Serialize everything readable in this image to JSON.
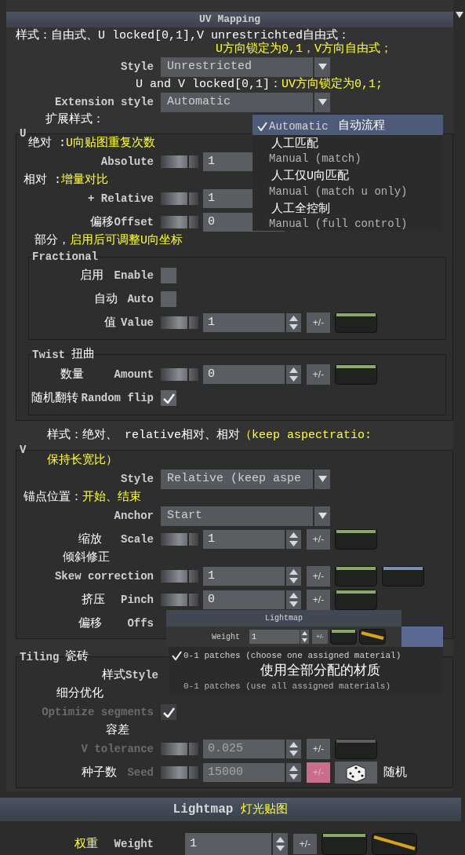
{
  "panel": {
    "title": "UV Mapping"
  },
  "style": {
    "label": "Style",
    "value": "Unrestricted"
  },
  "extension_style": {
    "label": "Extension style",
    "value": "Automatic"
  },
  "extension_menu": [
    {
      "label": "Automatic",
      "selected": true
    },
    {
      "label": "Manual (match)",
      "selected": false
    },
    {
      "label": "Manual (match u only)",
      "selected": false
    },
    {
      "label": "Manual (full control)",
      "selected": false
    }
  ],
  "u": {
    "title": "U",
    "rows": [
      {
        "label": "Absolute",
        "value": "1"
      },
      {
        "label": "+ Relative",
        "value": "1"
      },
      {
        "label": "Offset",
        "value": "0"
      }
    ]
  },
  "fractional": {
    "title": "Fractional",
    "checks": [
      {
        "label": "Enable",
        "checked": false
      },
      {
        "label": "Auto",
        "checked": false
      }
    ],
    "value": {
      "label": "Value",
      "value": "1",
      "button": "+/-",
      "curves": [
        {
          "kind": "flat",
          "color": "#8aa868"
        }
      ]
    }
  },
  "twist": {
    "title": "Twist",
    "amount": {
      "label": "Amount",
      "value": "0",
      "button": "+/-",
      "curves": [
        {
          "kind": "flat",
          "color": "#8aa868"
        }
      ]
    },
    "random_flip": {
      "label": "Random flip",
      "checked": true
    }
  },
  "v": {
    "title": "V",
    "style": {
      "label": "Style",
      "value": "Relative (keep aspe"
    },
    "anchor": {
      "label": "Anchor",
      "value": "Start"
    },
    "rows": [
      {
        "label": "Scale",
        "value": "1",
        "button": "+/-",
        "curves": [
          {
            "kind": "flat",
            "color": "#8aa868"
          }
        ]
      },
      {
        "label": "Skew correction",
        "value": "1",
        "button": "+/-",
        "curves": [
          {
            "kind": "flat",
            "color": "#8aa868"
          },
          {
            "kind": "flat",
            "color": "#7b8fae"
          }
        ]
      },
      {
        "label": "Pinch",
        "value": "0",
        "button": "+/-",
        "curves": [
          {
            "kind": "flat",
            "color": "#8aa868"
          }
        ]
      }
    ],
    "offset_label": "Offs"
  },
  "tiling": {
    "title": "Tiling",
    "style_label": "Style",
    "optimize": {
      "label": "Optimize segments",
      "checked": true,
      "disabled": true
    },
    "rows": [
      {
        "kind": "curve",
        "label": "V tolerance",
        "value": "0.025",
        "button": "+/-",
        "disabled": true,
        "keyed": false,
        "curves": [
          {
            "kind": "flat",
            "color": "#5e5e5e"
          }
        ]
      },
      {
        "kind": "dice",
        "label": "Seed",
        "value": "15000",
        "button": "+/-",
        "disabled": true,
        "keyed": true
      }
    ]
  },
  "popup": {
    "title": "Lightmap",
    "weight": {
      "label": "Weight",
      "value": "1",
      "button": "+/-",
      "curves": [
        {
          "kind": "flat",
          "color": "#8aa868"
        },
        {
          "kind": "ramp",
          "color": "#d8a31c"
        }
      ]
    },
    "menu": [
      {
        "label": "0-1 patches (choose one assigned material)",
        "selected": true
      },
      {
        "label": "0-1 patches (use all assigned materials)",
        "selected": false
      }
    ]
  },
  "lightmap": {
    "title": "Lightmap",
    "weight": {
      "label": "Weight",
      "value": "1",
      "button": "+/-",
      "curves": [
        {
          "kind": "flat",
          "color": "#8aa868"
        },
        {
          "kind": "ramp",
          "color": "#d8a31c"
        }
      ]
    }
  },
  "annotations": [
    {
      "segments": [
        {
          "text": "样式：自由式、U locked[0,1],V unrestrichted自由式：",
          "color": "#ffffff"
        }
      ]
    },
    {
      "segments": [
        {
          "text": "U方向锁定为0,1，V方向自由式；",
          "color": "#ffff33"
        }
      ]
    },
    {
      "segments": [
        {
          "text": "U and V locked[0,1]：",
          "color": "#ffffff"
        },
        {
          "text": "UV方向锁定为0,1;",
          "color": "#ffff33"
        }
      ]
    },
    {
      "segments": [
        {
          "text": "扩展样式：",
          "color": "#ffffff"
        }
      ]
    },
    {
      "segments": [
        {
          "text": "自动流程",
          "color": "#ffffff"
        }
      ]
    },
    {
      "segments": [
        {
          "text": "人工匹配",
          "color": "#ffffff"
        }
      ]
    },
    {
      "segments": [
        {
          "text": "人工仅U向匹配",
          "color": "#ffffff"
        }
      ]
    },
    {
      "segments": [
        {
          "text": "人工全控制",
          "color": "#ffffff"
        }
      ]
    },
    {
      "segments": [
        {
          "text": "绝对 :",
          "color": "#ffffff"
        },
        {
          "text": "U向贴图重复次数",
          "color": "#ffff33"
        }
      ]
    },
    {
      "segments": [
        {
          "text": "相对 :",
          "color": "#ffffff"
        },
        {
          "text": "增量对比",
          "color": "#ffff33"
        }
      ]
    },
    {
      "segments": [
        {
          "text": "偏移",
          "color": "#ffffff"
        }
      ]
    },
    {
      "segments": [
        {
          "text": "部分，",
          "color": "#ffffff"
        },
        {
          "text": "启用后可调整U向坐标",
          "color": "#ffff33"
        }
      ]
    },
    {
      "segments": [
        {
          "text": "启用",
          "color": "#ffffff"
        }
      ]
    },
    {
      "segments": [
        {
          "text": "自动",
          "color": "#ffffff"
        }
      ]
    },
    {
      "segments": [
        {
          "text": "值",
          "color": "#ffffff"
        }
      ]
    },
    {
      "segments": [
        {
          "text": "扭曲",
          "color": "#ffffff"
        }
      ]
    },
    {
      "segments": [
        {
          "text": "数量",
          "color": "#ffffff"
        }
      ]
    },
    {
      "segments": [
        {
          "text": "随机翻转",
          "color": "#ffffff"
        }
      ]
    },
    {
      "segments": [
        {
          "text": "样式：绝对、 relative相对、相对",
          "color": "#ffffff"
        },
        {
          "text": "（keep aspectratio:",
          "color": "#ffff33"
        }
      ]
    },
    {
      "segments": [
        {
          "text": "保持长宽比）",
          "color": "#ffff33"
        }
      ]
    },
    {
      "segments": [
        {
          "text": "锚点位置：",
          "color": "#ffffff"
        },
        {
          "text": "开始、结束",
          "color": "#ffff33"
        }
      ]
    },
    {
      "segments": [
        {
          "text": "缩放",
          "color": "#ffffff"
        }
      ]
    },
    {
      "segments": [
        {
          "text": "倾斜修正",
          "color": "#ffffff"
        }
      ]
    },
    {
      "segments": [
        {
          "text": "挤压",
          "color": "#ffffff"
        }
      ]
    },
    {
      "segments": [
        {
          "text": "偏移",
          "color": "#ffffff"
        }
      ]
    },
    {
      "segments": [
        {
          "text": "瓷砖",
          "color": "#ffffff"
        }
      ]
    },
    {
      "segments": [
        {
          "text": "样式",
          "color": "#ffffff"
        }
      ]
    },
    {
      "segments": [
        {
          "text": "使用全部分配的材质",
          "color": "#ffffff"
        }
      ]
    },
    {
      "segments": [
        {
          "text": "细分优化",
          "color": "#ffffff"
        }
      ]
    },
    {
      "segments": [
        {
          "text": "容差",
          "color": "#ffffff"
        }
      ]
    },
    {
      "segments": [
        {
          "text": "种子数",
          "color": "#ffffff"
        }
      ]
    },
    {
      "segments": [
        {
          "text": "随机",
          "color": "#ffffff"
        }
      ]
    },
    {
      "segments": [
        {
          "text": "灯光贴图",
          "color": "#ffff33"
        }
      ]
    },
    {
      "segments": [
        {
          "text": "权重",
          "color": "#ffff33"
        }
      ]
    }
  ]
}
